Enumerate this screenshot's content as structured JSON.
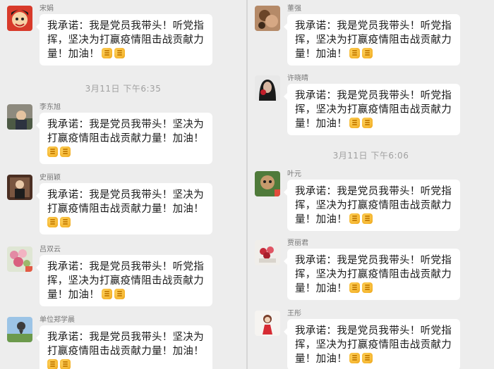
{
  "left": {
    "messages": [
      {
        "sender": "宋娟",
        "lines": [
          "我承诺：我是党员我带头！听党指",
          "挥，坚决为打赢疫情阻击战贡献力",
          "量！加油！"
        ]
      },
      {
        "sender": "李东旭",
        "lines": [
          "我承诺：我是党员我带头！坚决为",
          "打赢疫情阻击战贡献力量！加油！",
          ""
        ]
      },
      {
        "sender": "史丽颖",
        "lines": [
          "我承诺：我是党员我带头！坚决为",
          "打赢疫情阻击战贡献力量！加油！",
          ""
        ]
      },
      {
        "sender": "吕双云",
        "lines": [
          "我承诺：我是党员我带头！听党指",
          "挥，坚决为打赢疫情阻击战贡献力",
          "量！加油！"
        ]
      },
      {
        "sender": "单位郑学晨",
        "lines": [
          "我承诺：我是党员我带头！坚决为",
          "打赢疫情阻击战贡献力量！加油！",
          ""
        ]
      }
    ],
    "timestamp": "3月11日 下午6:35"
  },
  "right": {
    "messages": [
      {
        "sender": "董强",
        "lines": [
          "我承诺：我是党员我带头！听党指",
          "挥，坚决为打赢疫情阻击战贡献力",
          "量！加油！"
        ]
      },
      {
        "sender": "许晓晴",
        "lines": [
          "我承诺：我是党员我带头！听党指",
          "挥，坚决为打赢疫情阻击战贡献力",
          "量！加油！"
        ]
      },
      {
        "sender": "叶元",
        "lines": [
          "我承诺：我是党员我带头！听党指",
          "挥，坚决为打赢疫情阻击战贡献力",
          "量！加油！"
        ]
      },
      {
        "sender": "贾丽君",
        "lines": [
          "我承诺：我是党员我带头！听党指",
          "挥，坚决为打赢疫情阻击战贡献力",
          "量！加油！"
        ]
      },
      {
        "sender": "王彤",
        "lines": [
          "我承诺：我是党员我带头！听党指",
          "挥，坚决为打赢疫情阻击战贡献力",
          "量！加油！"
        ]
      }
    ],
    "timestamp": "3月11日 下午6:06"
  },
  "emoji_icon": "fist-emoji-icon"
}
